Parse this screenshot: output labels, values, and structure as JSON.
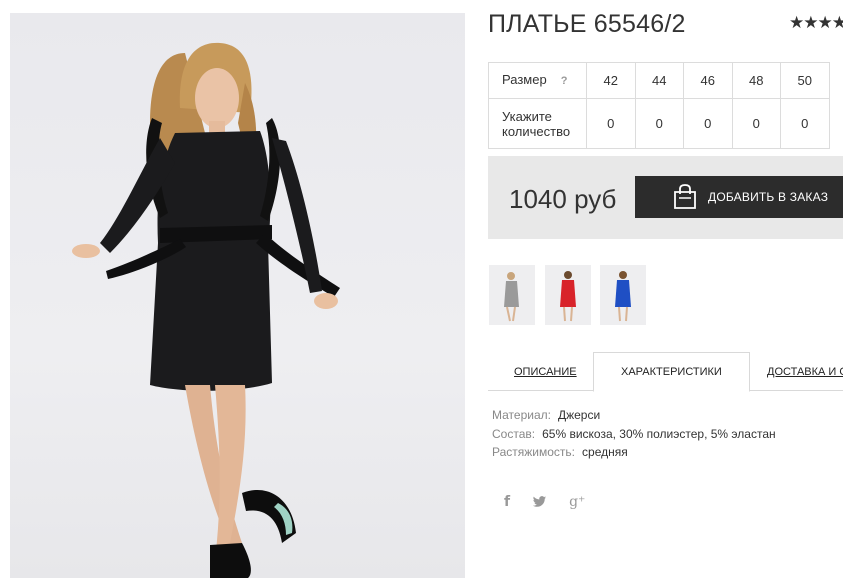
{
  "product": {
    "title": "ПЛАТЬЕ 65546/2",
    "rating_stars": "★★★★",
    "rating_value": 3.5
  },
  "sizes": {
    "size_label": "Размер",
    "help": "?",
    "qty_label": "Укажите количество",
    "values": [
      "42",
      "44",
      "46",
      "48",
      "50"
    ],
    "quantities": [
      "0",
      "0",
      "0",
      "0",
      "0"
    ]
  },
  "purchase": {
    "price": "1040 руб",
    "add_button": "ДОБАВИТЬ В ЗАКАЗ",
    "button_icon": "shopping-bag-icon"
  },
  "thumbnails": [
    {
      "name": "thumb-grey-dress",
      "color": "#9a9a9a"
    },
    {
      "name": "thumb-red-dress",
      "color": "#d8232a"
    },
    {
      "name": "thumb-blue-dress",
      "color": "#1f4fc4"
    }
  ],
  "tabs": {
    "description": "ОПИСАНИЕ",
    "characteristics": "ХАРАКТЕРИСТИКИ",
    "delivery": "ДОСТАВКА И О"
  },
  "characteristics": [
    {
      "key": "Материал:",
      "value": "Джерси"
    },
    {
      "key": "Состав:",
      "value": "65% вискоза, 30% полиэстер, 5% эластан"
    },
    {
      "key": "Растяжимость:",
      "value": "средняя"
    }
  ],
  "social": {
    "facebook": "f",
    "twitter": "🐦",
    "googleplus": "g⁺"
  },
  "colors": {
    "button_bg": "#2c2c2c",
    "band_bg": "#e8e8e8",
    "border": "#dcdcdc"
  }
}
